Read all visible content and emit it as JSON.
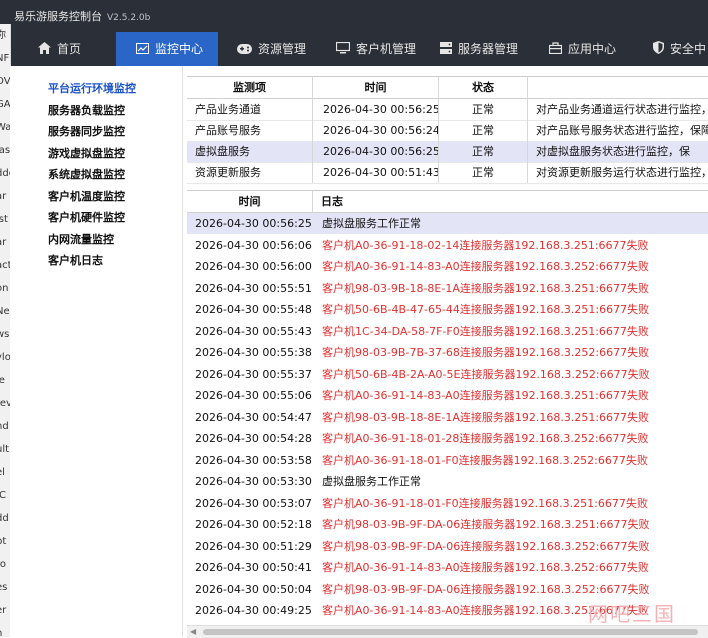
{
  "app": {
    "title": "易乐游服务控制台",
    "version": "V2.5.2.0b"
  },
  "nav": {
    "home": "首页",
    "monitor": "监控中心",
    "resources": "资源管理",
    "clients": "客户机管理",
    "servers": "服务器管理",
    "apps": "应用中心",
    "security": "安全中"
  },
  "left_strip": [
    "你",
    "NF",
    "OV",
    "GA",
    "Wa",
    "ias",
    "ddd",
    "ar",
    "ist",
    "ar",
    "act",
    "on",
    "Ne",
    "ws",
    "ylo",
    "le",
    "rev",
    "nd",
    "ult",
    "el",
    "IC",
    "dd",
    "pt",
    "ro",
    "es",
    "er",
    "n",
    "rv"
  ],
  "sidebar": {
    "items": [
      "平台运行环境监控",
      "服务器负载监控",
      "服务器同步监控",
      "游戏虚拟盘监控",
      "系统虚拟盘监控",
      "客户机温度监控",
      "客户机硬件监控",
      "内网流量监控",
      "客户机日志"
    ]
  },
  "status_table": {
    "headers": [
      "监测项",
      "时间",
      "状态",
      ""
    ],
    "rows": [
      {
        "item": "产品业务通道",
        "time": "2026-04-30 00:56:25",
        "status": "正常",
        "desc": "对产品业务通道运行状态进行监控，"
      },
      {
        "item": "产品账号服务",
        "time": "2026-04-30 00:56:24",
        "status": "正常",
        "desc": "对产品账号服务状态进行监控，保障"
      },
      {
        "item": "虚拟盘服务",
        "time": "2026-04-30 00:56:25",
        "status": "正常",
        "desc": "对虚拟盘服务状态进行监控，保"
      },
      {
        "item": "资源更新服务",
        "time": "2026-04-30 00:51:43",
        "status": "正常",
        "desc": "对资源更新服务运行状态进行监控，"
      }
    ]
  },
  "log_table": {
    "headers": [
      "时间",
      "日志"
    ],
    "rows": [
      {
        "time": "2026-04-30 00:56:25",
        "msg": "虚拟盘服务工作正常",
        "error": false
      },
      {
        "time": "2026-04-30 00:56:06",
        "msg": "客户机A0-36-91-18-02-14连接服务器192.168.3.251:6677失败",
        "error": true
      },
      {
        "time": "2026-04-30 00:56:00",
        "msg": "客户机A0-36-91-14-83-A0连接服务器192.168.3.252:6677失败",
        "error": true
      },
      {
        "time": "2026-04-30 00:55:51",
        "msg": "客户机98-03-9B-18-8E-1A连接服务器192.168.3.251:6677失败",
        "error": true
      },
      {
        "time": "2026-04-30 00:55:48",
        "msg": "客户机50-6B-4B-47-65-44连接服务器192.168.3.251:6677失败",
        "error": true
      },
      {
        "time": "2026-04-30 00:55:43",
        "msg": "客户机1C-34-DA-58-7F-F0连接服务器192.168.3.251:6677失败",
        "error": true
      },
      {
        "time": "2026-04-30 00:55:38",
        "msg": "客户机98-03-9B-7B-37-68连接服务器192.168.3.252:6677失败",
        "error": true
      },
      {
        "time": "2026-04-30 00:55:37",
        "msg": "客户机50-6B-4B-2A-A0-5E连接服务器192.168.3.252:6677失败",
        "error": true
      },
      {
        "time": "2026-04-30 00:55:06",
        "msg": "客户机A0-36-91-14-83-A0连接服务器192.168.3.251:6677失败",
        "error": true
      },
      {
        "time": "2026-04-30 00:54:47",
        "msg": "客户机98-03-9B-18-8E-1A连接服务器192.168.3.251:6677失败",
        "error": true
      },
      {
        "time": "2026-04-30 00:54:28",
        "msg": "客户机A0-36-91-18-01-28连接服务器192.168.3.252:6677失败",
        "error": true
      },
      {
        "time": "2026-04-30 00:53:58",
        "msg": "客户机A0-36-91-18-01-F0连接服务器192.168.3.252:6677失败",
        "error": true
      },
      {
        "time": "2026-04-30 00:53:30",
        "msg": "虚拟盘服务工作正常",
        "error": false
      },
      {
        "time": "2026-04-30 00:53:07",
        "msg": "客户机A0-36-91-18-01-F0连接服务器192.168.3.251:6677失败",
        "error": true
      },
      {
        "time": "2026-04-30 00:52:18",
        "msg": "客户机98-03-9B-9F-DA-06连接服务器192.168.3.251:6677失败",
        "error": true
      },
      {
        "time": "2026-04-30 00:51:29",
        "msg": "客户机98-03-9B-9F-DA-06连接服务器192.168.3.252:6677失败",
        "error": true
      },
      {
        "time": "2026-04-30 00:50:41",
        "msg": "客户机A0-36-91-14-83-A0连接服务器192.168.3.252:6677失败",
        "error": true
      },
      {
        "time": "2026-04-30 00:50:04",
        "msg": "客户机98-03-9B-9F-DA-06连接服务器192.168.3.252:6677失败",
        "error": true
      },
      {
        "time": "2026-04-30 00:49:25",
        "msg": "客户机A0-36-91-14-83-A0连接服务器192.168.3.252:6677失败",
        "error": true
      }
    ]
  },
  "watermark": "网吧三国",
  "colors": {
    "accent": "#2a66c8",
    "header_bg": "#2b2f38",
    "error_text": "#e03030",
    "selected_row": "#e4e4f7",
    "sidebar_active": "#1a53c9"
  }
}
